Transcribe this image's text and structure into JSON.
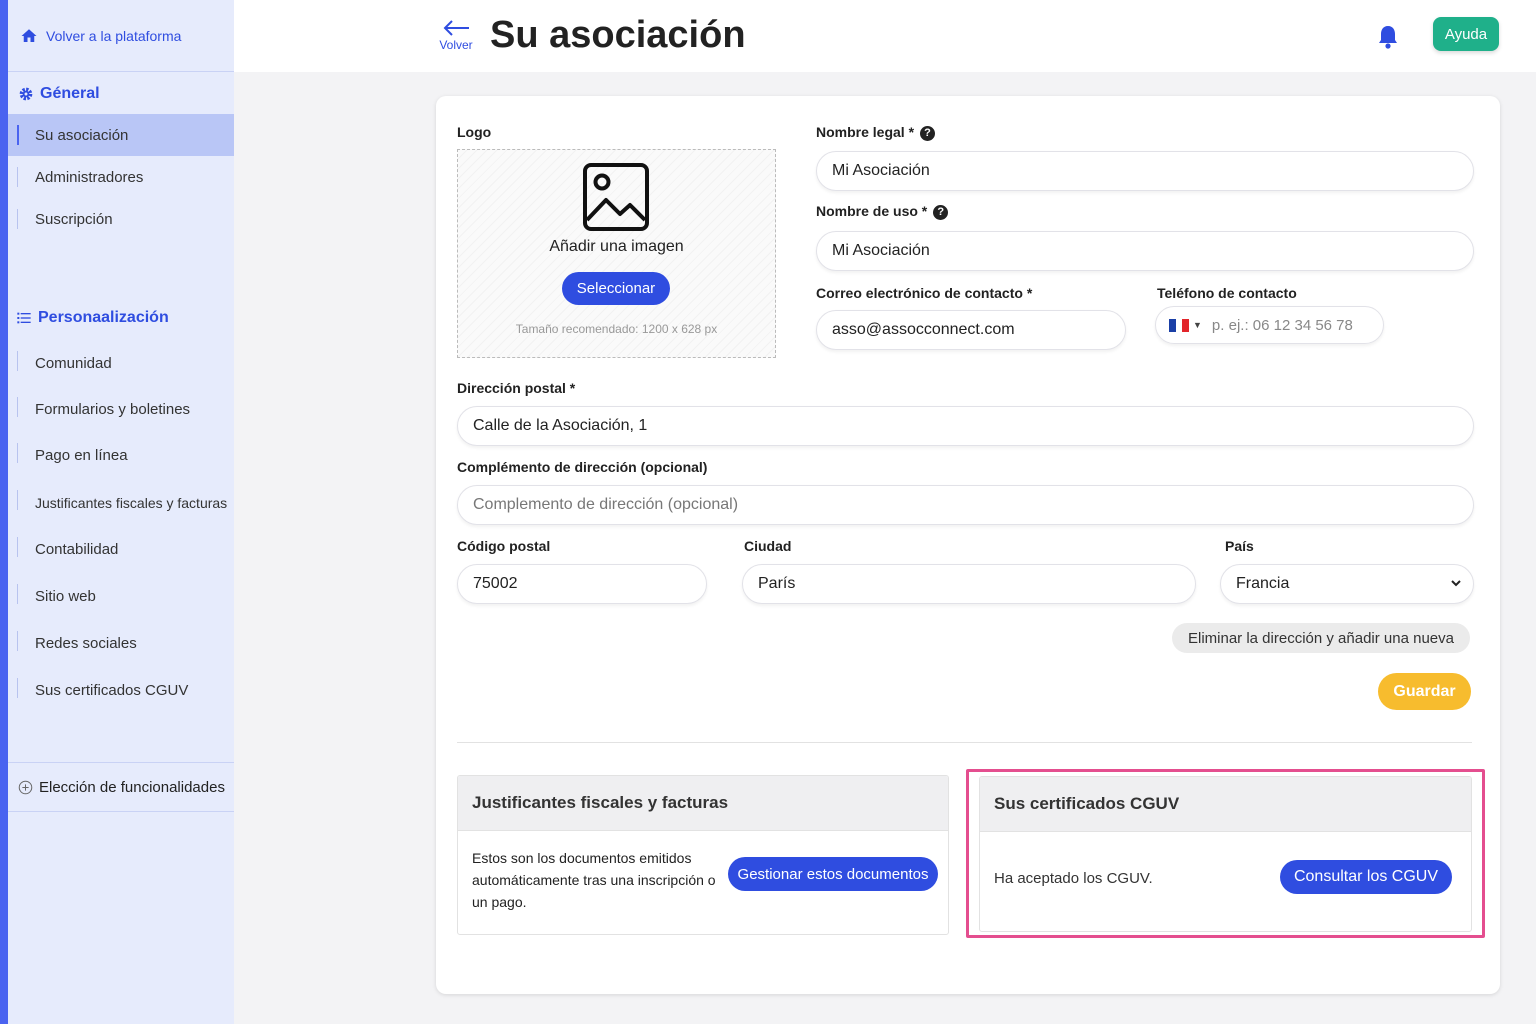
{
  "sidebar": {
    "back_label": "Volver a la plataforma",
    "section_general": "Géneral",
    "general_items": [
      "Su asociación",
      "Administradores",
      "Suscripción"
    ],
    "section_custom": "Personaalización",
    "custom_items": [
      "Comunidad",
      "Formularios y boletines",
      "Pago en línea",
      "Justificantes fiscales y facturas",
      "Contabilidad",
      "Sitio web",
      "Redes sociales",
      "Sus certificados CGUV"
    ],
    "features_label": "Elección de funcionalidades"
  },
  "header": {
    "back_label": "Volver",
    "title": "Su asociación",
    "help_label": "Ayuda"
  },
  "form": {
    "logo_label": "Logo",
    "logo_add_text": "Añadir una imagen",
    "logo_select_label": "Seleccionar",
    "logo_hint": "Tamaño recomendado: 1200 x 628 px",
    "legal_name_label": "Nombre legal *",
    "legal_name_value": "Mi Asociación",
    "use_name_label": "Nombre de uso *",
    "use_name_value": "Mi Asociación",
    "email_label": "Correo electrónico de contacto *",
    "email_value": "asso@assocconnect.com",
    "phone_label": "Teléfono de contacto",
    "phone_placeholder": "p. ej.: 06 12 34 56 78",
    "address_label": "Dirección postal *",
    "address_value": "Calle de la Asociación, 1",
    "address2_label": "Complémento de dirección (opcional)",
    "address2_placeholder": "Complemento de dirección (opcional)",
    "zip_label": "Código postal",
    "zip_value": "75002",
    "city_label": "Ciudad",
    "city_value": "París",
    "country_label": "País",
    "country_value": "Francia",
    "remove_address_label": "Eliminar la dirección y añadir una nueva",
    "save_label": "Guardar"
  },
  "panels": {
    "fiscal_title": "Justificantes fiscales y facturas",
    "fiscal_text": "Estos son los documentos emitidos automáticamente tras una inscripción o un pago.",
    "fiscal_button": "Gestionar estos documentos",
    "cguv_title": "Sus certificados CGUV",
    "cguv_text": "Ha aceptado los CGUV.",
    "cguv_button": "Consultar los CGUV"
  },
  "colors": {
    "accent": "#2f4de0",
    "help": "#1fb08a",
    "save": "#f7bc2e",
    "highlight": "#e44e8f"
  }
}
